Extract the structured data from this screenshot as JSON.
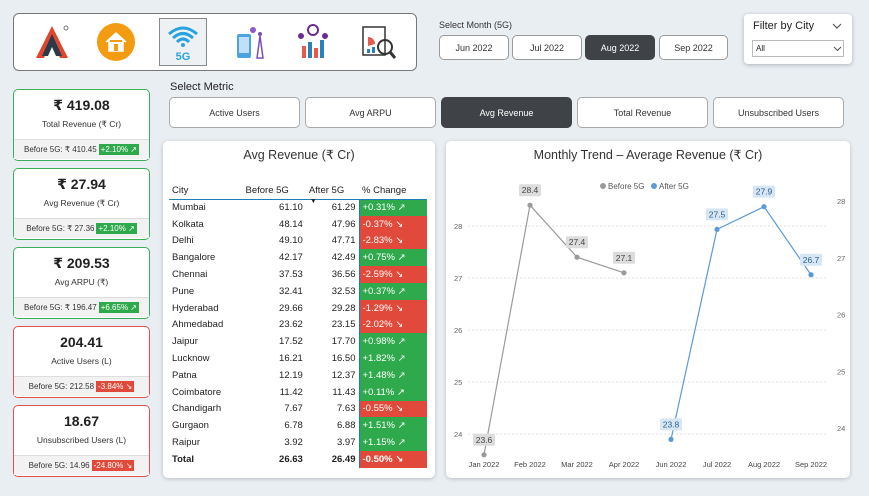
{
  "nav_icons": [
    {
      "name": "logo",
      "icon": "brand-logo"
    },
    {
      "name": "home",
      "icon": "home-icon"
    },
    {
      "name": "5g",
      "icon": "5g-wifi-icon",
      "label": "5G",
      "selected": true
    },
    {
      "name": "tower",
      "icon": "cell-tower-icon"
    },
    {
      "name": "analytics",
      "icon": "analytics-people-icon"
    },
    {
      "name": "report",
      "icon": "report-magnifier-icon"
    }
  ],
  "month_selector": {
    "title": "Select Month (5G)",
    "options": [
      "Jun 2022",
      "Jul 2022",
      "Aug 2022",
      "Sep 2022"
    ],
    "selected": "Aug 2022"
  },
  "city_filter": {
    "title": "Filter by City",
    "value": "All"
  },
  "kpis": [
    {
      "value": "₹ 419.08",
      "label": "Total Revenue (₹ Cr)",
      "before": "Before 5G: ₹ 410.45",
      "change": "+2.10% ↗",
      "status": "good"
    },
    {
      "value": "₹ 27.94",
      "label": "Avg Revenue (₹ Cr)",
      "before": "Before 5G: ₹ 27.36",
      "change": "+2.10% ↗",
      "status": "good"
    },
    {
      "value": "₹ 209.53",
      "label": "Avg ARPU (₹)",
      "before": "Before 5G: ₹ 196.47",
      "change": "+6.65% ↗",
      "status": "good"
    },
    {
      "value": "204.41",
      "label": "Active Users (L)",
      "before": "Before 5G: 212.58",
      "change": "-3.84% ↘",
      "status": "bad"
    },
    {
      "value": "18.67",
      "label": "Unsubscribed Users (L)",
      "before": "Before 5G: 14.96",
      "change": "-24.80% ↘",
      "status": "bad"
    }
  ],
  "metric_selector": {
    "title": "Select Metric",
    "options": [
      "Active Users",
      "Avg ARPU",
      "Avg Revenue",
      "Total Revenue",
      "Unsubscribed Users"
    ],
    "selected": "Avg Revenue"
  },
  "table": {
    "title": "Avg Revenue (₹ Cr)",
    "columns": [
      "City",
      "Before 5G",
      "After 5G",
      "% Change"
    ],
    "sort_column": "After 5G",
    "rows": [
      [
        "Mumbai",
        "61.10",
        "61.29",
        "+0.31% ↗"
      ],
      [
        "Kolkata",
        "48.14",
        "47.96",
        "-0.37% ↘"
      ],
      [
        "Delhi",
        "49.10",
        "47.71",
        "-2.83% ↘"
      ],
      [
        "Bangalore",
        "42.17",
        "42.49",
        "+0.75% ↗"
      ],
      [
        "Chennai",
        "37.53",
        "36.56",
        "-2.59% ↘"
      ],
      [
        "Pune",
        "32.41",
        "32.53",
        "+0.37% ↗"
      ],
      [
        "Hyderabad",
        "29.66",
        "29.28",
        "-1.29% ↘"
      ],
      [
        "Ahmedabad",
        "23.62",
        "23.15",
        "-2.02% ↘"
      ],
      [
        "Jaipur",
        "17.52",
        "17.70",
        "+0.98% ↗"
      ],
      [
        "Lucknow",
        "16.21",
        "16.50",
        "+1.82% ↗"
      ],
      [
        "Patna",
        "12.19",
        "12.37",
        "+1.48% ↗"
      ],
      [
        "Coimbatore",
        "11.42",
        "11.43",
        "+0.11% ↗"
      ],
      [
        "Chandigarh",
        "7.67",
        "7.63",
        "-0.55% ↘"
      ],
      [
        "Gurgaon",
        "6.78",
        "6.88",
        "+1.51% ↗"
      ],
      [
        "Raipur",
        "3.92",
        "3.97",
        "+1.15% ↗"
      ]
    ],
    "total": [
      "Total",
      "26.63",
      "26.49",
      "-0.50% ↘"
    ]
  },
  "colors": {
    "good": "#2eaa4c",
    "bad": "#e14a3a",
    "accent_dark": "#3f4347",
    "before_series": "#9a9a9a",
    "after_series": "#5b9bd5"
  },
  "chart_data": {
    "type": "line",
    "title": "Monthly Trend – Average Revenue (₹ Cr)",
    "categories": [
      "Jan 2022",
      "Feb 2022",
      "Mar 2022",
      "Apr 2022",
      "Jun 2022",
      "Jul 2022",
      "Aug 2022",
      "Sep 2022"
    ],
    "series": [
      {
        "name": "Before 5G",
        "axis": "left",
        "values": [
          23.6,
          28.4,
          27.4,
          27.1,
          null,
          null,
          null,
          null
        ]
      },
      {
        "name": "After 5G",
        "axis": "right",
        "values": [
          null,
          null,
          null,
          null,
          23.8,
          27.5,
          27.9,
          26.7
        ]
      }
    ],
    "data_labels": {
      "Before 5G": [
        "23.6",
        "28.4",
        "27.4",
        "27.1"
      ],
      "After 5G": [
        "23.8",
        "27.5",
        "27.9",
        "26.7"
      ]
    },
    "left_ticks": [
      24,
      25,
      26,
      27,
      28
    ],
    "right_ticks": [
      24,
      25,
      26,
      27,
      28
    ],
    "ylim_left": [
      23.4,
      28.6
    ],
    "ylim_right": [
      23.5,
      28.2
    ],
    "legend_position": "top-center",
    "grid": true
  }
}
